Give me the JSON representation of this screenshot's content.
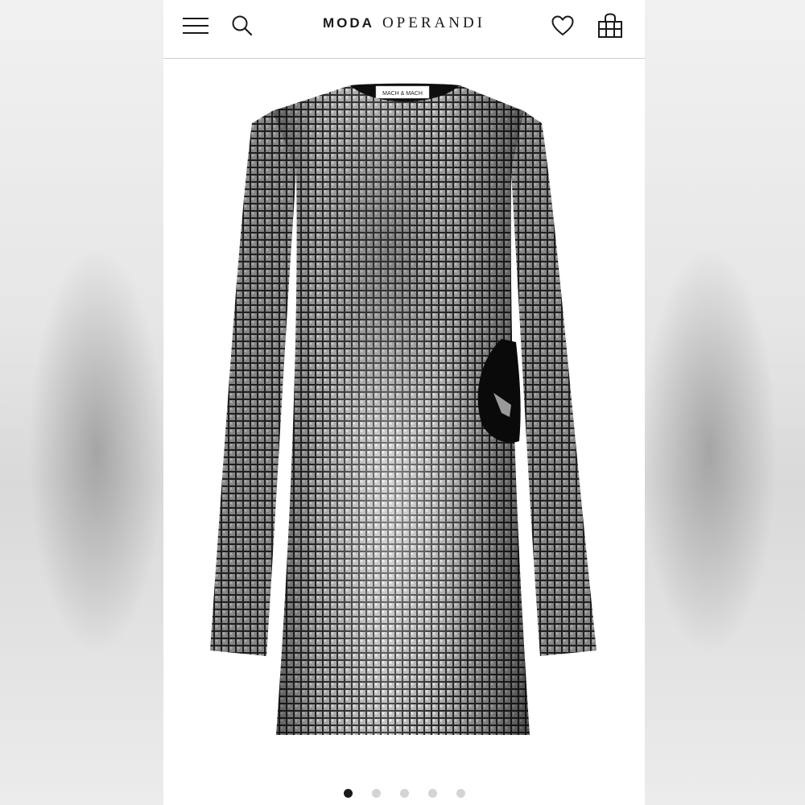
{
  "header": {
    "brand_primary": "MODA",
    "brand_secondary": "OPERANDI",
    "menu_icon": "hamburger-menu-icon",
    "search_icon": "search-icon",
    "wishlist_icon": "heart-icon",
    "bag_icon": "shopping-bag-icon"
  },
  "product": {
    "label_text": "MACH & MACH"
  },
  "carousel": {
    "total": 5,
    "active_index": 0
  },
  "colors": {
    "brand": "#1a1a1a",
    "dot_active": "#1a1a1a",
    "dot_inactive": "#d4d4d4"
  }
}
